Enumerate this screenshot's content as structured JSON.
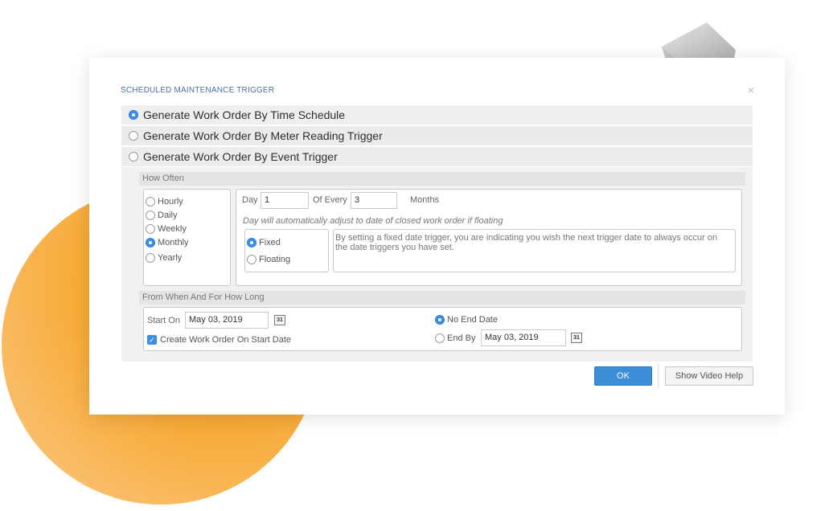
{
  "dialog": {
    "title": "SCHEDULED MAINTENANCE TRIGGER",
    "close_label": "×"
  },
  "trigger_options": [
    {
      "label": "Generate Work Order By Time Schedule",
      "selected": true
    },
    {
      "label": "Generate Work Order By Meter Reading Trigger",
      "selected": false
    },
    {
      "label": "Generate Work Order By Event Trigger",
      "selected": false
    }
  ],
  "how_often": {
    "header": "How Often",
    "frequencies": [
      {
        "label": "Hourly",
        "selected": false
      },
      {
        "label": "Daily",
        "selected": false
      },
      {
        "label": "Weekly",
        "selected": false
      },
      {
        "label": "Monthly",
        "selected": true
      },
      {
        "label": "Yearly",
        "selected": false
      }
    ],
    "day_label": "Day",
    "day_value": "1",
    "of_every_label": "Of Every",
    "of_every_value": "3",
    "months_label": "Months",
    "note": "Day will automatically adjust to date of closed work order if floating",
    "mode_options": [
      {
        "label": "Fixed",
        "selected": true
      },
      {
        "label": "Floating",
        "selected": false
      }
    ],
    "description": "By setting a fixed date trigger, you are indicating you wish the next trigger date to always occur on the date triggers you have set."
  },
  "date_range": {
    "header": "From When And For How Long",
    "start_on_label": "Start On",
    "start_on_value": "May 03, 2019",
    "calendar_glyph": "31",
    "create_on_start_label": "Create Work Order On Start Date",
    "create_on_start_checked": true,
    "no_end_label": "No End Date",
    "no_end_selected": true,
    "end_by_label": "End By",
    "end_by_value": "May 03, 2019",
    "end_by_selected": false
  },
  "buttons": {
    "ok": "OK",
    "video_help": "Show Video Help"
  },
  "colors": {
    "accent": "#3b8ee8",
    "orange": "#f5a022"
  }
}
